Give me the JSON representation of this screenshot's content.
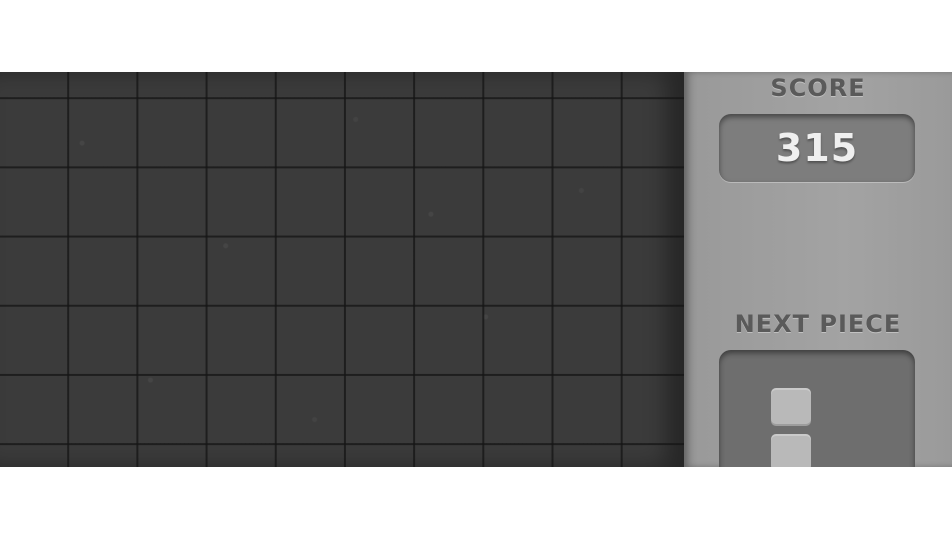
{
  "sidebar": {
    "score_label": "SCORE",
    "score_value": "315",
    "next_label": "NEXT PIECE",
    "next_piece": {
      "visible_blocks": 2,
      "orientation": "vertical"
    }
  },
  "colors": {
    "board_background": "#3b3b3b",
    "grid_line": "#1a1a1a",
    "panel_background": "#a3a3a3",
    "score_box": "#7d7d7d",
    "score_text": "#efefef",
    "label_text": "#5a5a5a",
    "piece_block": "#b9b9b9"
  }
}
